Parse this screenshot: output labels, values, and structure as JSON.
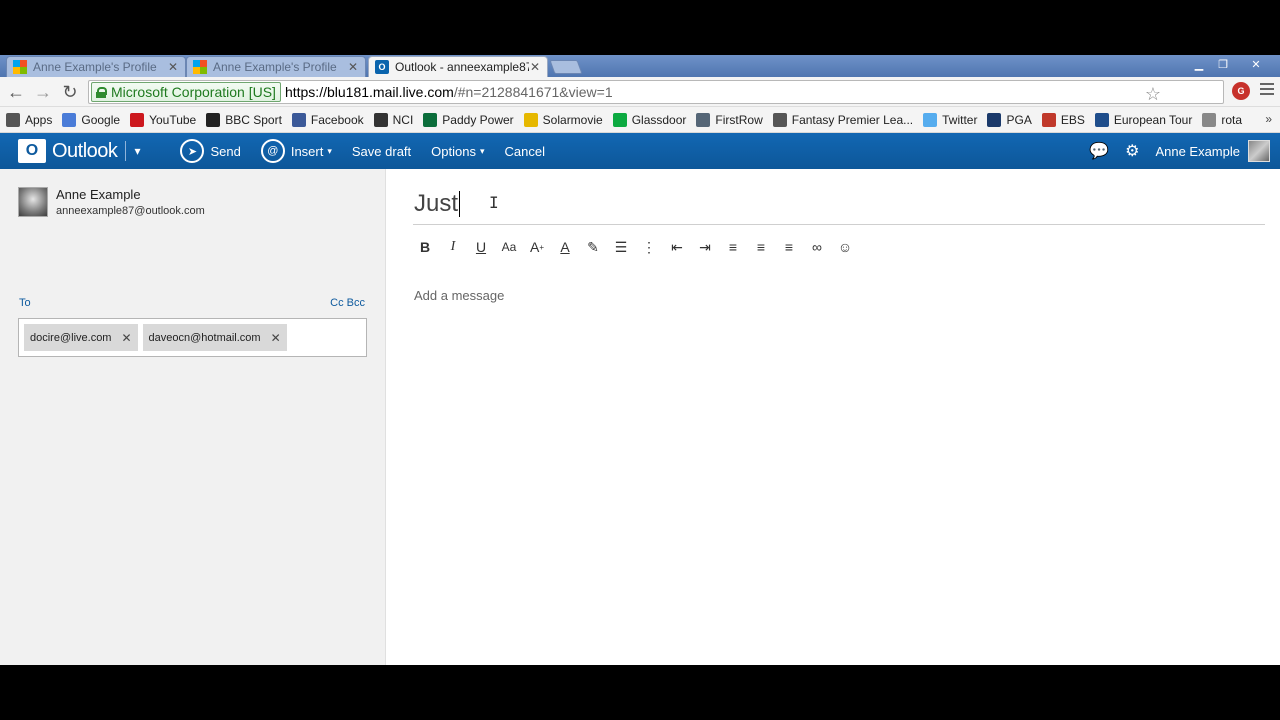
{
  "browser": {
    "tabs": [
      {
        "title": "Anne Example's Profile",
        "favicon": "microsoft-icon",
        "active": false
      },
      {
        "title": "Anne Example's Profile",
        "favicon": "microsoft-icon",
        "active": false
      },
      {
        "title": "Outlook - anneexample87",
        "favicon": "outlook-icon",
        "active": true
      }
    ],
    "ev_cert": "Microsoft Corporation [US]",
    "url_host": "https://blu181.mail.live.com",
    "url_path": "/#n=2128841671&view=1",
    "bookmarks": [
      {
        "label": "Apps",
        "icon": "apps-grid-icon",
        "color": "#555555"
      },
      {
        "label": "Google",
        "icon": "google-icon",
        "color": "#4a7cd8"
      },
      {
        "label": "YouTube",
        "icon": "youtube-icon",
        "color": "#cc181e"
      },
      {
        "label": "BBC Sport",
        "icon": "bbc-icon",
        "color": "#222222"
      },
      {
        "label": "Facebook",
        "icon": "facebook-icon",
        "color": "#3b5998"
      },
      {
        "label": "NCI",
        "icon": "nci-icon",
        "color": "#333333"
      },
      {
        "label": "Paddy Power",
        "icon": "paddy-power-icon",
        "color": "#0b6e3b"
      },
      {
        "label": "Solarmovie",
        "icon": "solarmovie-icon",
        "color": "#e6b800"
      },
      {
        "label": "Glassdoor",
        "icon": "glassdoor-icon",
        "color": "#0caa41"
      },
      {
        "label": "FirstRow",
        "icon": "firstrow-icon",
        "color": "#556677"
      },
      {
        "label": "Fantasy Premier Lea...",
        "icon": "premier-league-icon",
        "color": "#555555"
      },
      {
        "label": "Twitter",
        "icon": "twitter-icon",
        "color": "#55acee"
      },
      {
        "label": "PGA",
        "icon": "pga-icon",
        "color": "#1b3a6b"
      },
      {
        "label": "EBS",
        "icon": "ebs-icon",
        "color": "#c0392b"
      },
      {
        "label": "European Tour",
        "icon": "european-tour-icon",
        "color": "#1f4e8c"
      },
      {
        "label": "rota",
        "icon": "document-icon",
        "color": "#888888"
      }
    ],
    "bookmarks_more": "»"
  },
  "outlook": {
    "brand": "Outlook",
    "send": "Send",
    "insert": "Insert",
    "save_draft": "Save draft",
    "options": "Options",
    "cancel": "Cancel",
    "user_name": "Anne Example",
    "accent": "#0d5a9e"
  },
  "sender": {
    "name": "Anne Example",
    "email": "anneexample87@outlook.com"
  },
  "recipients": {
    "to_label": "To",
    "cc_bcc": "Cc Bcc",
    "items": [
      "docire@live.com",
      "daveocn@hotmail.com"
    ]
  },
  "compose": {
    "subject": "Just",
    "message_placeholder": "Add a message"
  }
}
